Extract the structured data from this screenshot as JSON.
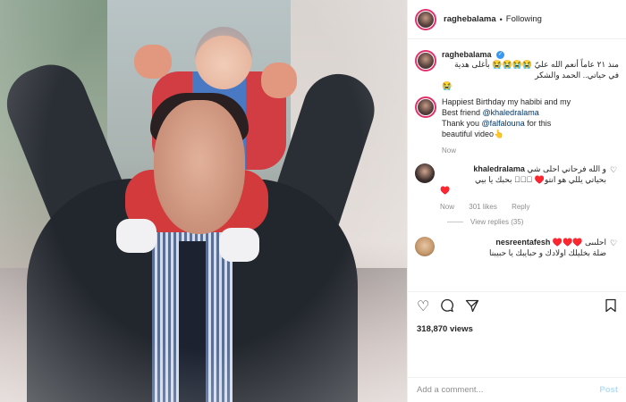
{
  "post": {
    "username": "raghebalama",
    "follow_state": "Following",
    "view_count": "318,870 views"
  },
  "caption": {
    "username": "raghebalama",
    "lines": [
      "منذ ٢١ عاماً أنعم الله عليّ 😭😭😭😭 بأغلى هدية في حياتي.. الحمد والشكر",
      "😭"
    ],
    "text_en": [
      "Happiest Birthday my habibi and my",
      "Best friend ",
      "Thank you ",
      " for this",
      "beautiful video👆"
    ],
    "mention1": "@khaledralama",
    "mention2": "@falfalouna",
    "time": "Now"
  },
  "comments": [
    {
      "username": "khaledralama",
      "text": [
        "و الله فرحاني احلى شي",
        "بحياتي يللي هو انتو♥️ 🏻🏻🏻 بحبك يا بيي",
        "♥️"
      ],
      "time": "Now",
      "likes": "301 likes",
      "reply": "Reply",
      "view_replies": "View replies (35)"
    },
    {
      "username": "nesreentafesh",
      "text": [
        "احلىىى ♥️♥️♥️",
        "ضلة بخليلك اولادك و حبايبك يا حبيبنا"
      ]
    }
  ],
  "actions": {
    "like_icon": "heart-icon",
    "comment_icon": "comment-icon",
    "share_icon": "share-icon",
    "save_icon": "bookmark-icon"
  },
  "add_comment": {
    "placeholder": "Add a comment...",
    "post_label": "Post"
  }
}
